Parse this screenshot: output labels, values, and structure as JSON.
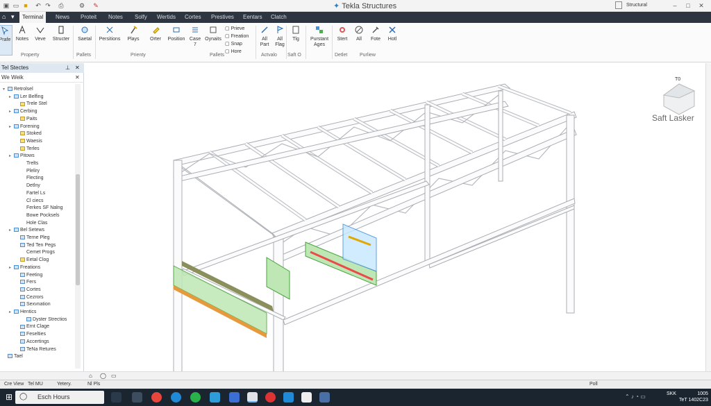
{
  "app": {
    "title": "Tekla Structures",
    "profile": "Structural"
  },
  "tabs": [
    "Terminal",
    "News",
    "Proteit",
    "Notes",
    "Solfy",
    "Wertids",
    "Cortes",
    "Prestives",
    "Eentars",
    "Clatch"
  ],
  "ribbon": {
    "buttons": [
      {
        "label": "Prafe",
        "icon": "pointer-icon"
      },
      {
        "label": "Notes",
        "icon": "letter-a-icon"
      },
      {
        "label": "Veve",
        "icon": "heart-icon"
      },
      {
        "label": "Structer",
        "icon": "bookmark-icon"
      },
      {
        "label": "Saetal",
        "icon": "view-icon"
      },
      {
        "label": "Persitions",
        "icon": "palette-icon"
      },
      {
        "label": "Plays",
        "icon": "hammer-icon"
      },
      {
        "label": "Orter",
        "icon": "pin-icon"
      },
      {
        "label": "Position",
        "icon": "tag-icon"
      },
      {
        "label": "Case 7",
        "icon": "checklist-icon"
      },
      {
        "label": "Oynaits",
        "icon": "stack-icon"
      },
      {
        "label": "All Part",
        "icon": "brush-icon"
      },
      {
        "label": "All Flag",
        "icon": "flag-icon"
      },
      {
        "label": "Tlg",
        "icon": "page-icon"
      },
      {
        "label": "Purstant Ages",
        "icon": "network-icon"
      },
      {
        "label": "Stert",
        "icon": "target-icon"
      },
      {
        "label": "All",
        "icon": "circle-slash-icon"
      },
      {
        "label": "Fote",
        "icon": "wrench-icon"
      },
      {
        "label": "Hotl",
        "icon": "tools-icon"
      }
    ],
    "checks": [
      "Prieve",
      "Freation",
      "Snap",
      "Hore"
    ],
    "groups": [
      "Property",
      "Pallets",
      "Prienty",
      "Pallets",
      "Actvalo",
      "Saft O",
      "Detlet",
      "Purliew"
    ]
  },
  "panel": {
    "title": "Tel Stectes",
    "subtitle": "We Weik",
    "tree": [
      {
        "label": "Retrolsel",
        "level": 0,
        "twisty": "▾",
        "icon": "folder"
      },
      {
        "label": "Ler Belfing",
        "level": 1,
        "twisty": "▸",
        "icon": "folder"
      },
      {
        "label": "Trele Stel",
        "level": 2,
        "twisty": "",
        "icon": "yellow"
      },
      {
        "label": "Cerbing",
        "level": 1,
        "twisty": "▸",
        "icon": "folder"
      },
      {
        "label": "Paits",
        "level": 2,
        "twisty": "",
        "icon": "yellow"
      },
      {
        "label": "Forening",
        "level": 1,
        "twisty": "▸",
        "icon": "folder"
      },
      {
        "label": "Stoked",
        "level": 2,
        "twisty": "",
        "icon": "yellow"
      },
      {
        "label": "Waesis",
        "level": 2,
        "twisty": "",
        "icon": "yellow"
      },
      {
        "label": "Terles",
        "level": 2,
        "twisty": "",
        "icon": "yellow"
      },
      {
        "label": "Pitows",
        "level": 1,
        "twisty": "▸",
        "icon": "folder"
      },
      {
        "label": "Trelts",
        "level": 3,
        "twisty": "",
        "icon": ""
      },
      {
        "label": "Pleliry",
        "level": 3,
        "twisty": "",
        "icon": ""
      },
      {
        "label": "Flecting",
        "level": 3,
        "twisty": "",
        "icon": ""
      },
      {
        "label": "Detlny",
        "level": 3,
        "twisty": "",
        "icon": ""
      },
      {
        "label": "Fartel Ls",
        "level": 3,
        "twisty": "",
        "icon": ""
      },
      {
        "label": "Cl ciecs",
        "level": 3,
        "twisty": "",
        "icon": ""
      },
      {
        "label": "Ferkes SF Nalng",
        "level": 3,
        "twisty": "",
        "icon": ""
      },
      {
        "label": "Bowe Pocksels",
        "level": 3,
        "twisty": "",
        "icon": ""
      },
      {
        "label": "Hole Clas",
        "level": 3,
        "twisty": "",
        "icon": ""
      },
      {
        "label": "Bel Setews",
        "level": 1,
        "twisty": "▸",
        "icon": "folder"
      },
      {
        "label": "Terne Pleg",
        "level": 2,
        "twisty": "",
        "icon": "folder"
      },
      {
        "label": "Ted Ten Pegs",
        "level": 2,
        "twisty": "",
        "icon": "folder"
      },
      {
        "label": "Cemet Progs",
        "level": 3,
        "twisty": "",
        "icon": ""
      },
      {
        "label": "Eetal Clog",
        "level": 2,
        "twisty": "",
        "icon": "yellow"
      },
      {
        "label": "Freations",
        "level": 1,
        "twisty": "▸",
        "icon": "folder"
      },
      {
        "label": "Feeting",
        "level": 2,
        "twisty": "",
        "icon": "folder"
      },
      {
        "label": "Fers",
        "level": 2,
        "twisty": "",
        "icon": "folder"
      },
      {
        "label": "Cortes",
        "level": 2,
        "twisty": "",
        "icon": "folder"
      },
      {
        "label": "Cezrors",
        "level": 2,
        "twisty": "",
        "icon": "folder"
      },
      {
        "label": "Sexvnation",
        "level": 2,
        "twisty": "",
        "icon": "folder"
      },
      {
        "label": "Hentics",
        "level": 1,
        "twisty": "▸",
        "icon": "folder"
      },
      {
        "label": "Dyster Strectios",
        "level": 3,
        "twisty": "",
        "icon": "folder"
      },
      {
        "label": "Ernt Clage",
        "level": 2,
        "twisty": "",
        "icon": "folder"
      },
      {
        "label": "Feselties",
        "level": 2,
        "twisty": "",
        "icon": "folder"
      },
      {
        "label": "Accertings",
        "level": 2,
        "twisty": "",
        "icon": "folder"
      },
      {
        "label": "TeNa Retures",
        "level": 2,
        "twisty": "",
        "icon": "folder"
      },
      {
        "label": "Tael",
        "level": 0,
        "twisty": "",
        "icon": "folder"
      }
    ]
  },
  "viewport": {
    "overlay_label": "Saft Lasker",
    "cube_label": "T0"
  },
  "status": {
    "items": [
      "Cre View",
      "Tel MU",
      "Yetery.",
      "Nl Pls"
    ],
    "right": "Poll"
  },
  "taskbar": {
    "search_placeholder": "Esch Hours",
    "clock_time": "1005",
    "clock_date": "TeT 1402C23",
    "tray_label": "SKK"
  }
}
